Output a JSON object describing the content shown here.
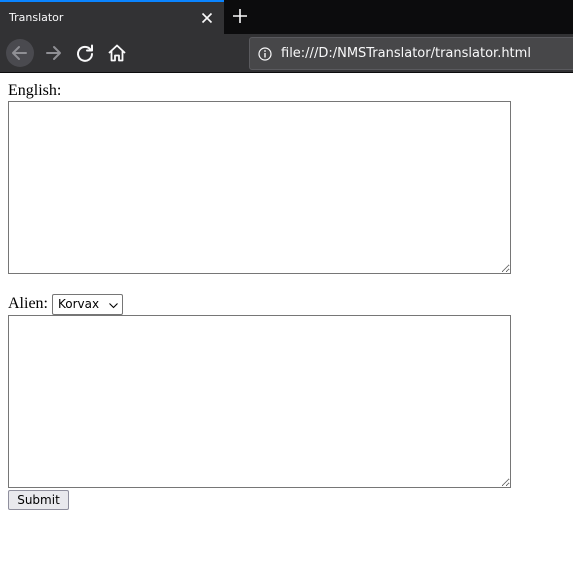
{
  "browser": {
    "tab": {
      "title": "Translator"
    },
    "address_bar": {
      "url": "file:///D:/NMSTranslator/translator.html"
    },
    "accent_color": "#0a84ff"
  },
  "form": {
    "english_label": "English:",
    "english_text": "",
    "alien_label": "Alien:",
    "alien_language": {
      "selected": "Korvax"
    },
    "alien_text": "",
    "submit_label": "Submit"
  }
}
